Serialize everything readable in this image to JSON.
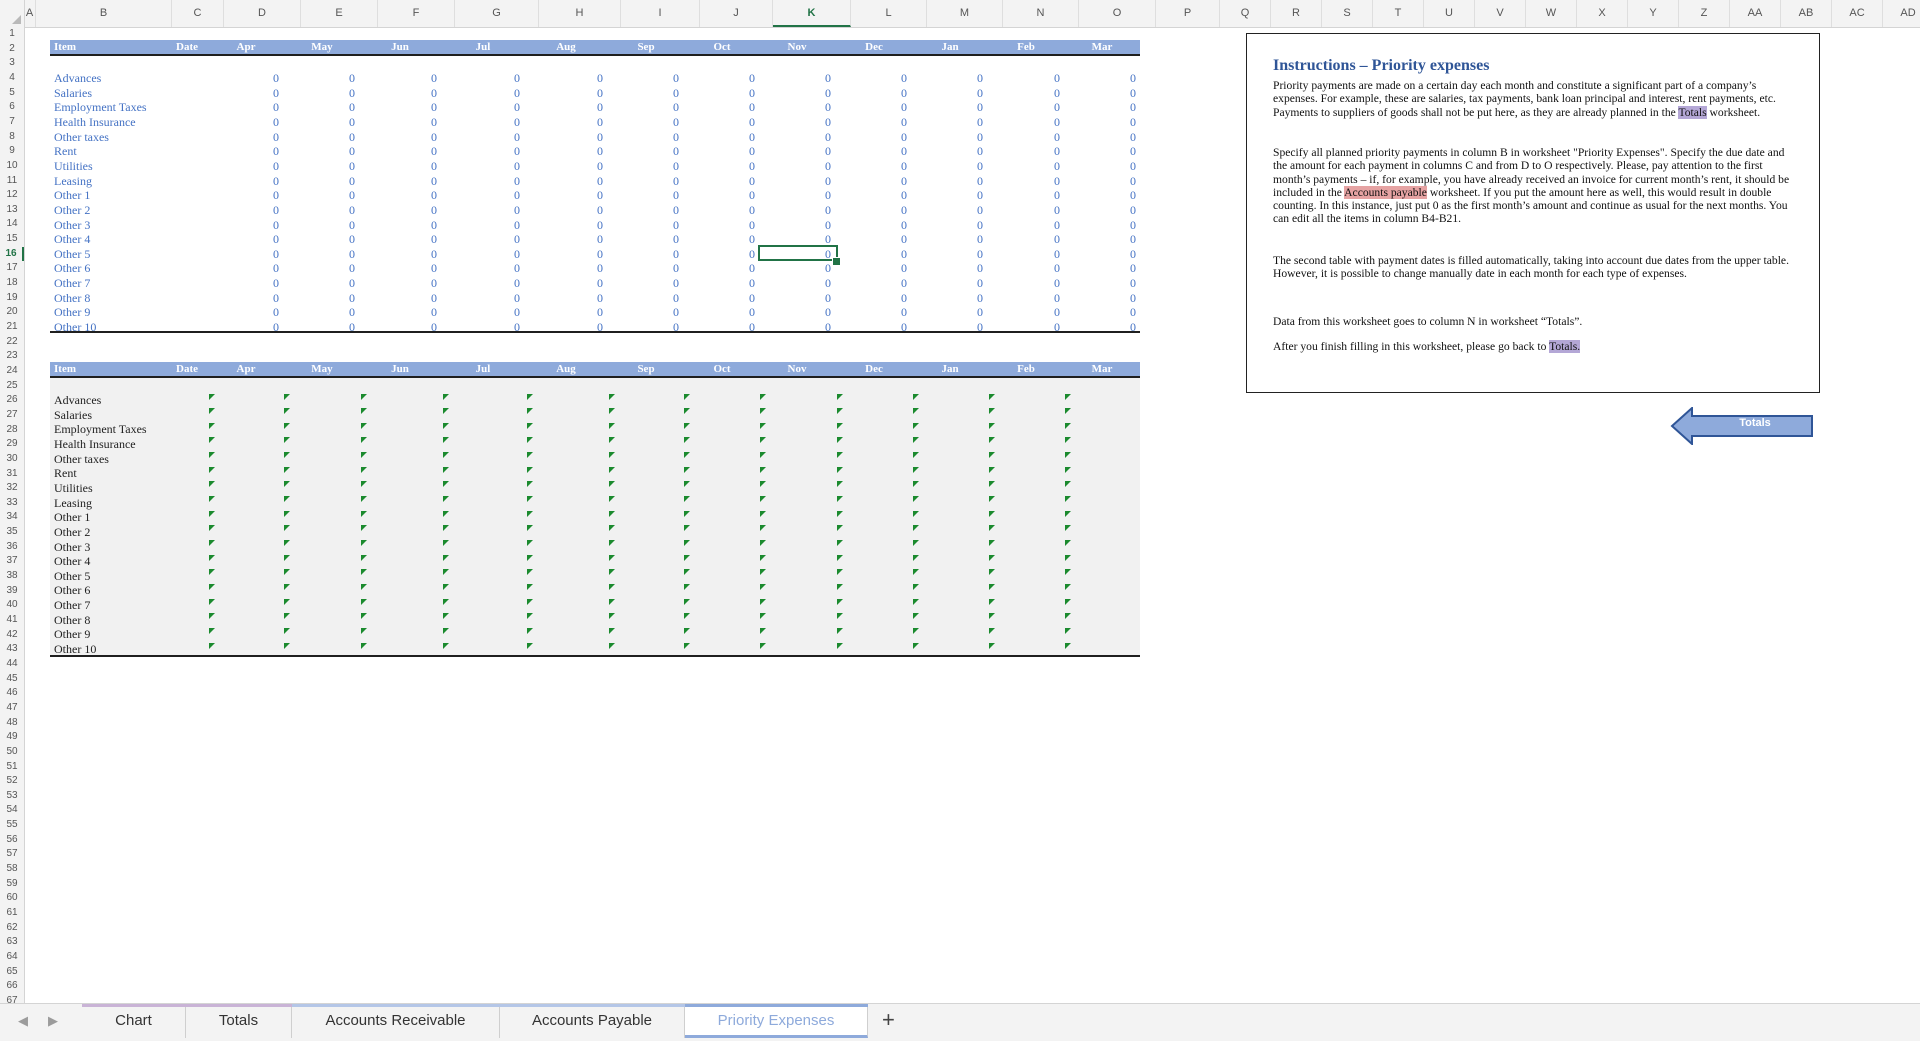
{
  "columns": [
    "A",
    "B",
    "C",
    "D",
    "E",
    "F",
    "G",
    "H",
    "I",
    "J",
    "K",
    "L",
    "M",
    "N",
    "O",
    "P",
    "Q",
    "R",
    "S",
    "T",
    "U",
    "V",
    "W",
    "X",
    "Y",
    "Z",
    "AA",
    "AB",
    "AC",
    "AD"
  ],
  "selected_column": "K",
  "selected_row": 16,
  "row_count": 67,
  "table_header": {
    "item": "Item",
    "date": "Date",
    "months": [
      "Apr",
      "May",
      "Jun",
      "Jul",
      "Aug",
      "Sep",
      "Oct",
      "Nov",
      "Dec",
      "Jan",
      "Feb",
      "Mar"
    ]
  },
  "items": [
    "Advances",
    "Salaries",
    "Employment Taxes",
    "Health Insurance",
    "Other taxes",
    "Rent",
    "Utilities",
    "Leasing",
    "Other 1",
    "Other 2",
    "Other 3",
    "Other 4",
    "Other 5",
    "Other 6",
    "Other 7",
    "Other 8",
    "Other 9",
    "Other 10"
  ],
  "cell_value": "0",
  "instructions": {
    "title": "Instructions – Priority expenses",
    "p1_a": "Priority payments are made on a certain day each month and constitute a significant part of a company’s expenses. For example, these are salaries, tax payments, bank loan principal and interest, rent payments, etc. Payments to suppliers of goods shall not be put here, as they are already planned in the ",
    "p1_link": "Totals",
    "p1_b": " worksheet.",
    "p2_a": "Specify all planned priority payments in column B in worksheet \"Priority Expenses\". Specify the due date and the amount for each payment in columns C and from D to O  respectively. Please, pay attention to the first month’s payments – if, for example, you have already received an invoice for current month’s rent, it should be included in the ",
    "p2_link": "Accounts payable",
    "p2_b": " worksheet. If you put the amount here as well, this would result in double counting. In this instance, just put 0 as the first month’s amount and continue as usual for the next months. You can edit all the items in column B4-B21.",
    "p3": "The second table with payment dates is filled automatically, taking into account due dates from the upper table. However, it is possible to change manually date in each month for each type of expenses.",
    "p4": "Data from this worksheet goes to column N in worksheet “Totals”.",
    "p5_a": "After you finish filling in this worksheet, please go back to ",
    "p5_link": "Totals."
  },
  "back_button_label": "Totals",
  "sheet_tabs": [
    {
      "label": "Chart",
      "color": "#c9b3d6"
    },
    {
      "label": "Totals",
      "color": "#c9b3d6"
    },
    {
      "label": "Accounts Receivable",
      "color": "#b4c6e7"
    },
    {
      "label": "Accounts Payable",
      "color": "#b4c6e7"
    },
    {
      "label": "Priority Expenses",
      "color": "#8eaadb"
    }
  ],
  "active_tab": "Priority Expenses",
  "add_sheet_label": "+",
  "nav_prev": "◀",
  "nav_next": "▶",
  "colors": {
    "header_blue": "#8eaadb",
    "value_blue": "#4472c4",
    "flag_green": "#1b8a2e",
    "selection_green": "#217346",
    "title_blue": "#2f5597"
  }
}
